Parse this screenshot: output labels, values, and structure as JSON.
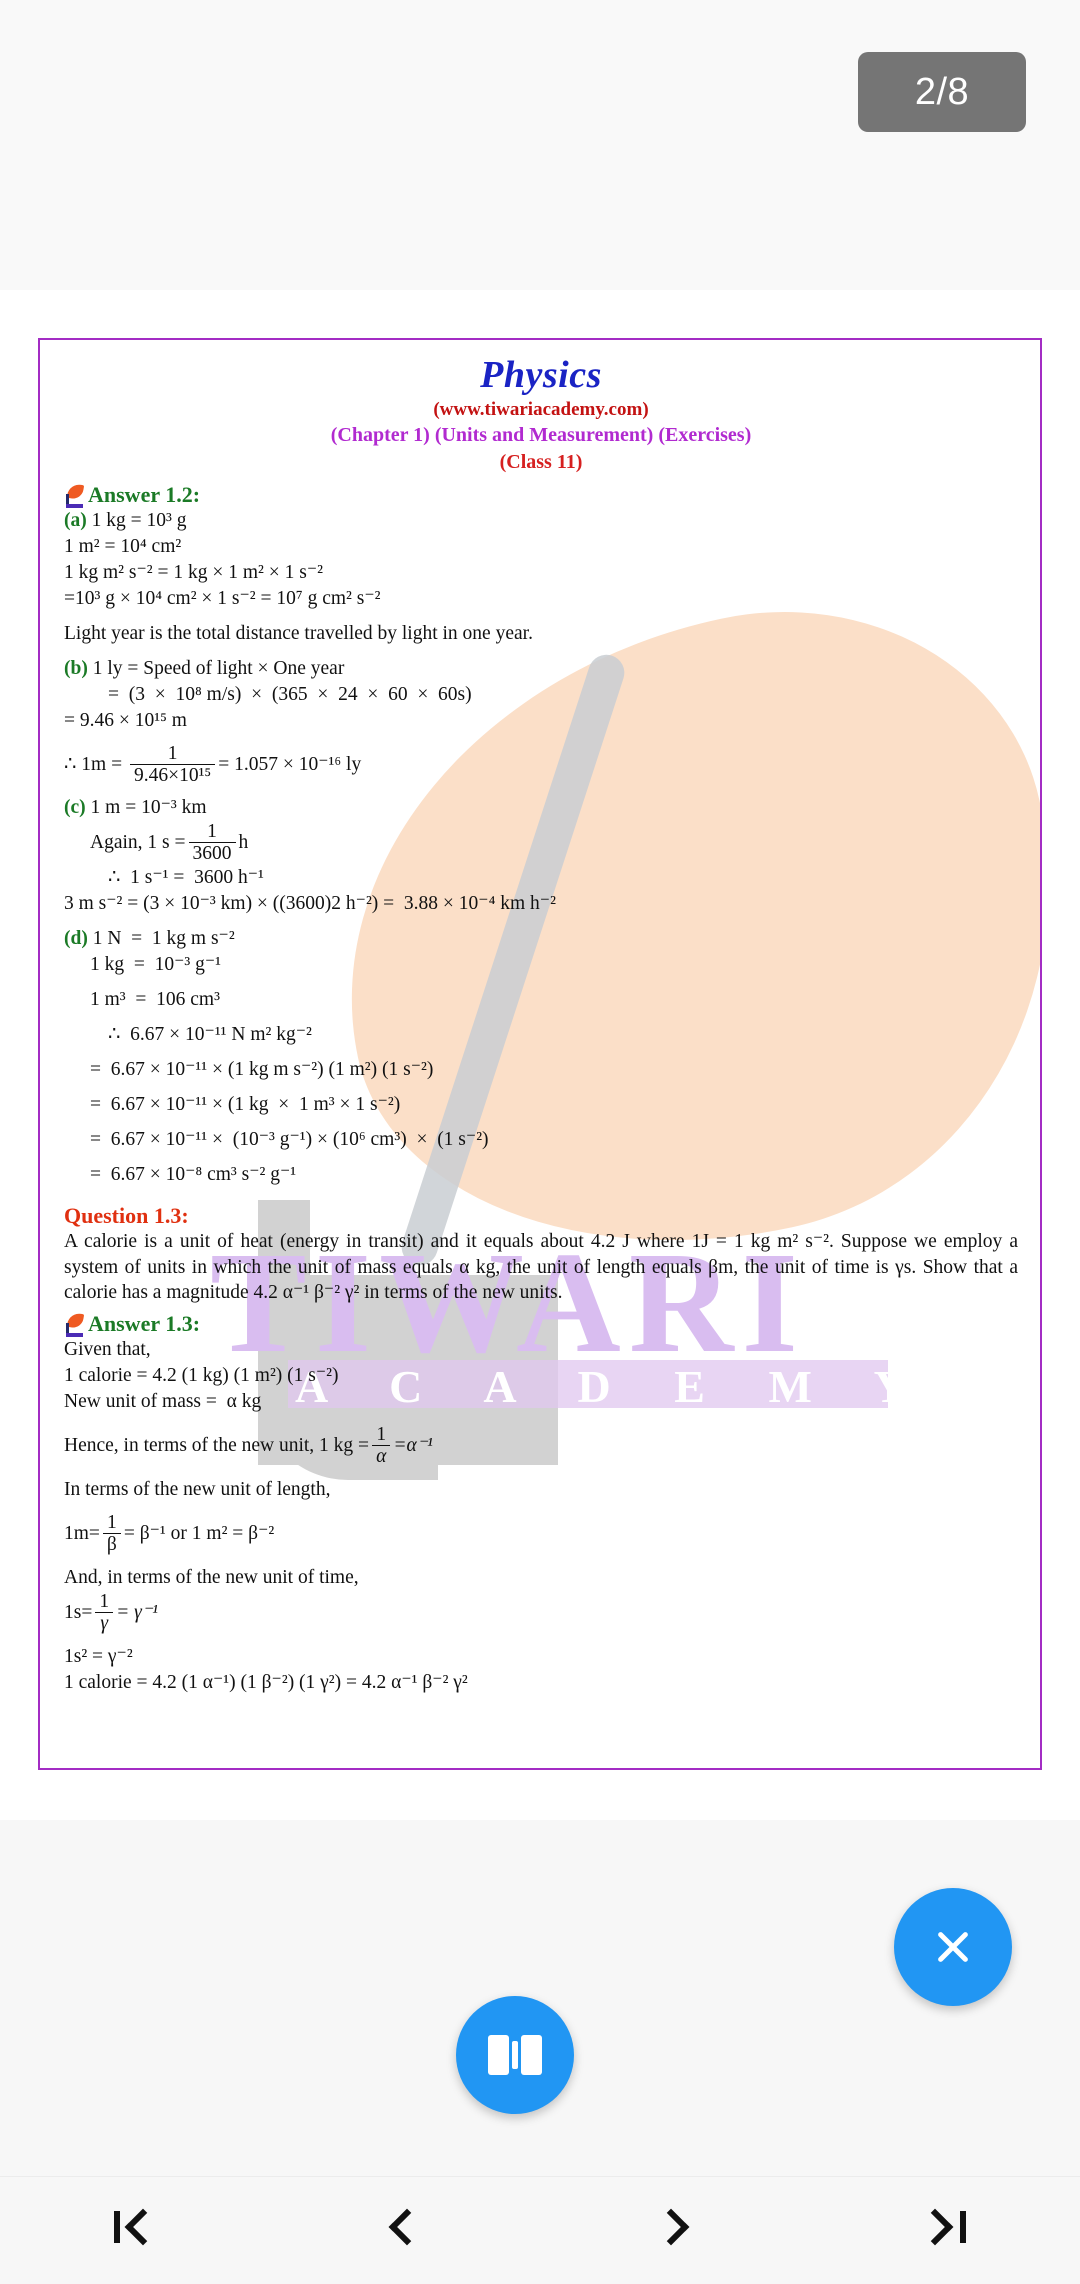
{
  "topbar": {
    "page_indicator": "2/8"
  },
  "document": {
    "header": {
      "title": "Physics",
      "site": "(www.tiwariacademy.com)",
      "chapter": "(Chapter 1) (Units and Measurement) (Exercises)",
      "class": "(Class 11)"
    },
    "watermark": {
      "big": "TIWARI",
      "band": "A C A D E M Y"
    },
    "answer_1_2": {
      "title": "Answer 1.2:",
      "a_label": "(a)",
      "a_line1_rest": " 1 kg = 10³ g",
      "lines_a": [
        "1 m² = 10⁴ cm²",
        "1 kg m² s⁻² = 1 kg × 1 m² × 1 s⁻²",
        "=10³ g × 10⁴ cm² × 1 s⁻² = 10⁷ g cm² s⁻²",
        "Light year is the total distance travelled by light in one year."
      ],
      "b_label": "(b)",
      "b_line1_rest": " 1 ly = Speed of light × One year",
      "b_line2": "=  (3  ×  10⁸ m/s)  ×  (365  ×  24  ×  60  ×  60s)",
      "b_line3": "= 9.46 × 10¹⁵ m",
      "b_frac_prefix": "∴ 1m = ",
      "b_frac_num": "1",
      "b_frac_den": "9.46×10¹⁵",
      "b_frac_suffix": "= 1.057 × 10⁻¹⁶ ly",
      "c_label": "(c)",
      "c_line1_rest": " 1 m = 10⁻³ km",
      "c_again_prefix": "Again, 1 s =",
      "c_frac_num": "1",
      "c_frac_den": "3600",
      "c_frac_suffix": "h",
      "c_line3": "∴  1 s⁻¹ =  3600 h⁻¹",
      "c_line4": "3 m s⁻² = (3 × 10⁻³ km) × ((3600)2 h⁻²) =  3.88 × 10⁻⁴ km h⁻²",
      "d_label": "(d)",
      "d_line1_rest": " 1 N  =  1 kg m s⁻²",
      "lines_d": [
        "1 kg  =  10⁻³ g⁻¹",
        "1 m³  =  106 cm³",
        "∴  6.67 × 10⁻¹¹ N m² kg⁻²",
        "=  6.67 × 10⁻¹¹ × (1 kg m s⁻²) (1 m²) (1 s⁻²)",
        "=  6.67 × 10⁻¹¹ × (1 kg  ×  1 m³ × 1 s⁻²)",
        "=  6.67 × 10⁻¹¹ ×  (10⁻³ g⁻¹) × (10⁶ cm³)  ×  (1 s⁻²)",
        "=  6.67 × 10⁻⁸ cm³ s⁻² g⁻¹"
      ]
    },
    "question_1_3": {
      "title": "Question 1.3:",
      "body": "A calorie is a unit of heat (energy in transit) and it equals about 4.2 J where 1J  =  1 kg m² s⁻². Suppose we employ a system of units in which the unit of mass equals α kg, the unit of length equals βm, the unit of time is γs. Show that a calorie has a magnitude 4.2 α⁻¹ β⁻² γ² in terms of the new units."
    },
    "answer_1_3": {
      "title": "Answer 1.3:",
      "given": "Given that,",
      "line1": "1 calorie = 4.2 (1 kg) (1 m²) (1 s⁻²)",
      "line2": "New unit of mass =  α kg",
      "hence_prefix": "Hence, in terms of the new unit, 1 kg =",
      "hence_num": "1",
      "hence_den": "α",
      "hence_suffix": "=α⁻¹",
      "length_intro": "In terms of the new unit of length,",
      "len_prefix": "1m=",
      "len_num": "1",
      "len_den": "β",
      "len_suffix": "= β⁻¹ or 1 m² = β⁻²",
      "time_intro": "And, in terms of the new unit of time,",
      "time_prefix": "1s=",
      "time_num": "1",
      "time_den": "γ",
      "time_suffix": "= γ⁻¹",
      "time_line2": "1s² = γ⁻²",
      "final": "1 calorie = 4.2 (1 α⁻¹) (1 β⁻²) (1 γ²) = 4.2 α⁻¹ β⁻² γ²"
    }
  },
  "controls": {
    "close_label": "close-fab",
    "book_label": "book-fab",
    "nav": {
      "first": "first-page",
      "prev": "previous-page",
      "next": "next-page",
      "last": "last-page"
    }
  },
  "colors": {
    "accent_blue": "#2196f3",
    "border_purple": "#a32cc4",
    "heading_blue": "#1a23c4",
    "heading_red": "#c31212",
    "heading_magenta": "#b12ad0",
    "answer_green": "#1b7a26",
    "question_red": "#e03010",
    "badge_grey": "#757575"
  }
}
